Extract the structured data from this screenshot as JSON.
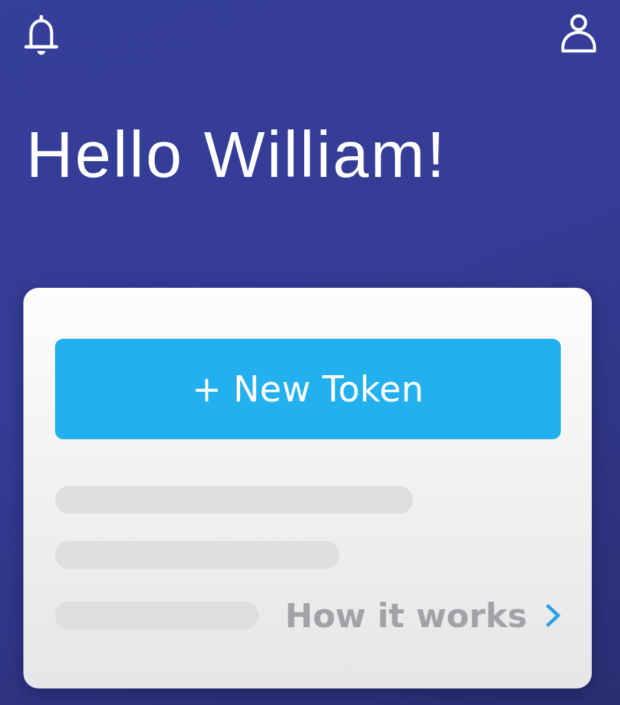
{
  "greeting": "Hello William!",
  "card": {
    "button": "+ New Token",
    "link": "How it works"
  }
}
